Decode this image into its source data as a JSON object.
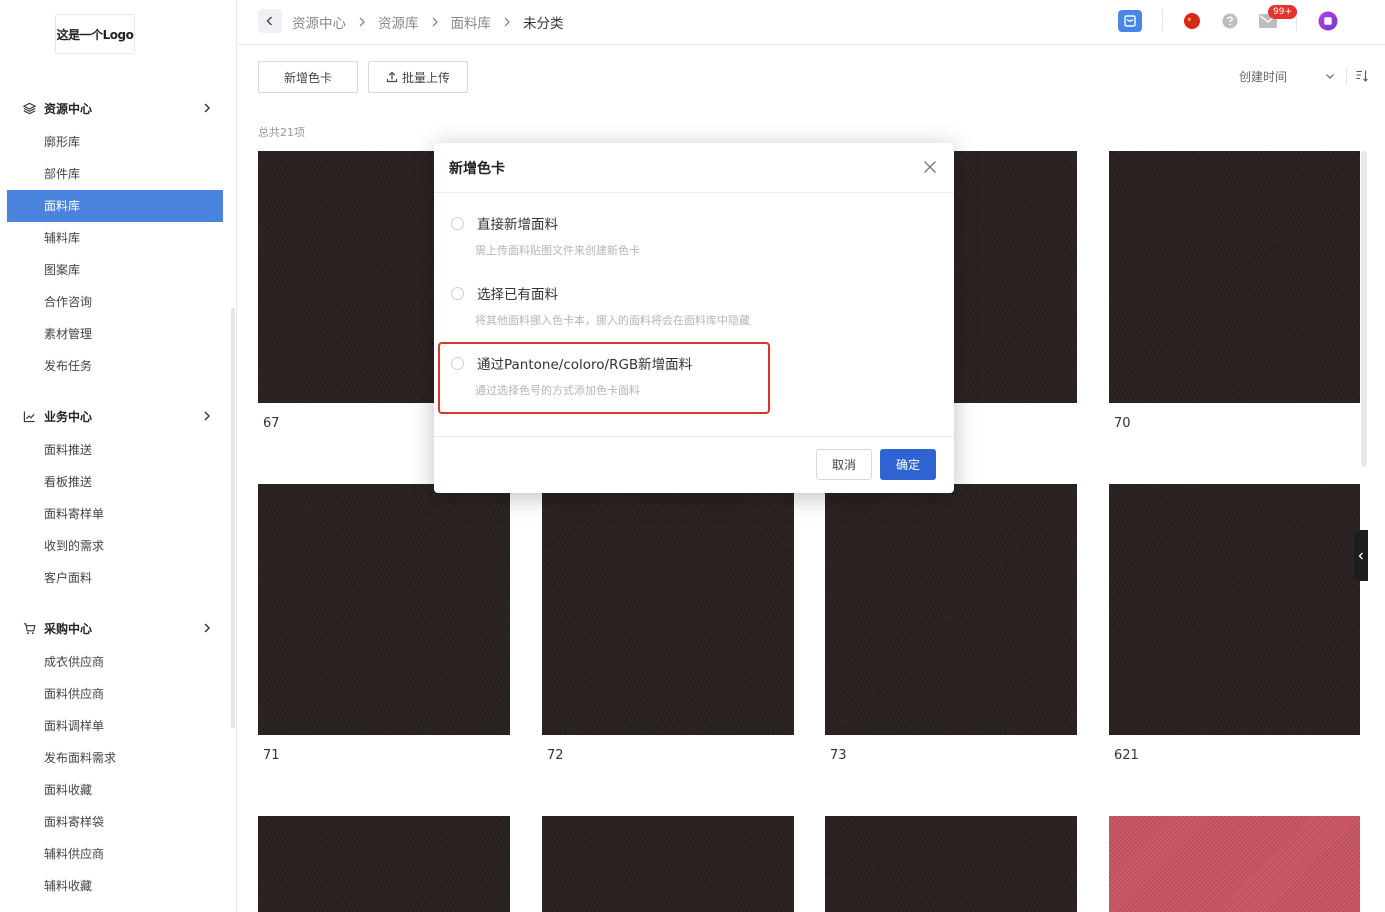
{
  "logo": {
    "text": "这是一个Logo"
  },
  "sidebar": {
    "sections": [
      {
        "label": "资源中心",
        "icon": "layers-icon",
        "items": [
          "廓形库",
          "部件库",
          "面料库",
          "辅料库",
          "图案库",
          "合作咨询",
          "素材管理",
          "发布任务"
        ],
        "active": "面料库"
      },
      {
        "label": "业务中心",
        "icon": "chart-line-icon",
        "items": [
          "面料推送",
          "看板推送",
          "面料寄样单",
          "收到的需求",
          "客户面料"
        ]
      },
      {
        "label": "采购中心",
        "icon": "cart-icon",
        "items": [
          "成衣供应商",
          "面料供应商",
          "面料调样单",
          "发布面料需求",
          "面料收藏",
          "面料寄样袋",
          "辅料供应商",
          "辅料收藏"
        ]
      }
    ]
  },
  "header": {
    "breadcrumb": [
      "资源中心",
      "资源库",
      "面料库",
      "未分类"
    ],
    "notification_badge": "99+",
    "icons": [
      "inbox-icon",
      "china-flag-icon",
      "help-icon",
      "mail-icon",
      "avatar-icon"
    ]
  },
  "toolbar": {
    "add_color_card": "新增色卡",
    "batch_upload": "批量上传",
    "sort_label": "创建时间",
    "total": "总共21项"
  },
  "grid": {
    "cards": [
      {
        "label": "67",
        "color": "#2a2322"
      },
      {
        "label": "",
        "color": "#2a2322"
      },
      {
        "label": "",
        "color": "#2a2322"
      },
      {
        "label": "70",
        "color": "#2a2322"
      },
      {
        "label": "71",
        "color": "#2a2322"
      },
      {
        "label": "72",
        "color": "#2a2322"
      },
      {
        "label": "73",
        "color": "#2a2322"
      },
      {
        "label": "621",
        "color": "#2a2322"
      },
      {
        "label": "",
        "color": "#2a2322"
      },
      {
        "label": "",
        "color": "#2a2322"
      },
      {
        "label": "",
        "color": "#2a2322"
      },
      {
        "label": "",
        "color": "#cf5868"
      }
    ]
  },
  "modal": {
    "title": "新增色卡",
    "options": [
      {
        "label": "直接新增面料",
        "desc": "需上传面料贴图文件来创建新色卡"
      },
      {
        "label": "选择已有面料",
        "desc": "将其他面料挪入色卡本，挪入的面料将会在面料库中隐藏"
      },
      {
        "label": "通过Pantone/coloro/RGB新增面料",
        "desc": "通过选择色号的方式添加色卡面料"
      }
    ],
    "cancel": "取消",
    "confirm": "确定"
  },
  "colors": {
    "accent": "#2f63d1",
    "nav_active": "#4a83de",
    "highlight": "#d9372b",
    "fabric_dark": "#2a2322",
    "fabric_pink": "#cf5868"
  }
}
